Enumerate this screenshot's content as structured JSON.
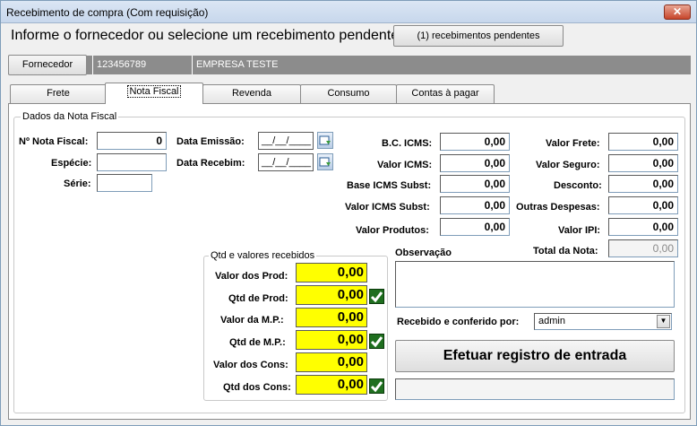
{
  "window": {
    "title": "Recebimento de compra (Com requisição)",
    "close_label": "✕"
  },
  "header": {
    "prompt": "Informe o fornecedor ou selecione um recebimento pendente:",
    "pending_button": "(1) recebimentos pendentes"
  },
  "supplier": {
    "button": "Fornecedor",
    "code": "123456789",
    "name": "EMPRESA TESTE"
  },
  "tabs": [
    {
      "label": "Frete"
    },
    {
      "label": "Nota Fiscal"
    },
    {
      "label": "Revenda"
    },
    {
      "label": "Consumo"
    },
    {
      "label": "Contas à pagar"
    }
  ],
  "active_tab": "Nota Fiscal",
  "nota": {
    "group_label": "Dados da Nota Fiscal",
    "numero_label": "Nº Nota Fiscal:",
    "numero_value": "0",
    "especie_label": "Espécie:",
    "especie_value": "",
    "serie_label": "Série:",
    "serie_value": "",
    "emissao_label": "Data Emissão:",
    "emissao_value": "__/__/____",
    "recebim_label": "Data Recebim:",
    "recebim_value": "__/__/____"
  },
  "icms": {
    "bc_label": "B.C. ICMS:",
    "bc_value": "0,00",
    "valor_label": "Valor ICMS:",
    "valor_value": "0,00",
    "base_subst_label": "Base ICMS Subst:",
    "base_subst_value": "0,00",
    "valor_subst_label": "Valor ICMS Subst:",
    "valor_subst_value": "0,00",
    "produtos_label": "Valor Produtos:",
    "produtos_value": "0,00"
  },
  "valores": {
    "frete_label": "Valor Frete:",
    "frete_value": "0,00",
    "seguro_label": "Valor Seguro:",
    "seguro_value": "0,00",
    "desconto_label": "Desconto:",
    "desconto_value": "0,00",
    "outras_label": "Outras Despesas:",
    "outras_value": "0,00",
    "ipi_label": "Valor IPI:",
    "ipi_value": "0,00",
    "total_label": "Total da Nota:",
    "total_value": "0,00"
  },
  "recebidos": {
    "group_label": "Qtd e valores recebidos",
    "rows": [
      {
        "label": "Valor dos Prod:",
        "value": "0,00"
      },
      {
        "label": "Qtd de Prod:",
        "value": "0,00"
      },
      {
        "label": "Valor da M.P.:",
        "value": "0,00"
      },
      {
        "label": "Qtd de M.P.:",
        "value": "0,00"
      },
      {
        "label": "Valor dos Cons:",
        "value": "0,00"
      },
      {
        "label": "Qtd dos Cons:",
        "value": "0,00"
      }
    ]
  },
  "observacao": {
    "label": "Observação",
    "value": ""
  },
  "conferido": {
    "label": "Recebido e conferido por:",
    "value": "admin"
  },
  "submit": {
    "label": "Efetuar registro de entrada"
  },
  "status": {
    "text": ""
  },
  "colors": {
    "highlight": "#ffff00",
    "check": "#1f6f1f",
    "band": "#8c8c8c"
  }
}
